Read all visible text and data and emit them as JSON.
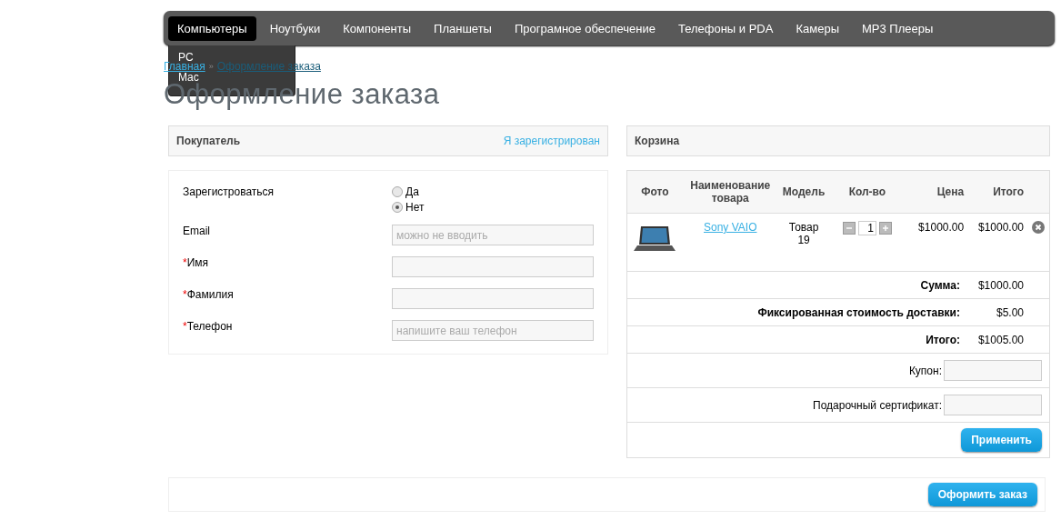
{
  "nav": {
    "items": [
      {
        "label": "Компьютеры",
        "selected": true
      },
      {
        "label": "Ноутбуки",
        "selected": false
      },
      {
        "label": "Компоненты",
        "selected": false
      },
      {
        "label": "Планшеты",
        "selected": false
      },
      {
        "label": "Програмное обеспечение",
        "selected": false
      },
      {
        "label": "Телефоны и PDA",
        "selected": false
      },
      {
        "label": "Камеры",
        "selected": false
      },
      {
        "label": "MP3 Плееры",
        "selected": false
      }
    ],
    "dropdown": [
      "PC",
      "Mac"
    ]
  },
  "breadcrumb": {
    "items": [
      "Главная",
      "Оформление заказа"
    ],
    "separator": "»"
  },
  "page_title": "Оформление заказа",
  "customer": {
    "title": "Покупатель",
    "login_link": "Я зарегистрирован",
    "required_mark": "*",
    "fields": [
      {
        "kind": "radio",
        "label": "Зарегистроваться",
        "options": [
          {
            "label": "Да",
            "selected": false
          },
          {
            "label": "Нет",
            "selected": true
          }
        ]
      },
      {
        "kind": "text",
        "label": "Email",
        "required": false,
        "placeholder": "можно не вводить"
      },
      {
        "kind": "text",
        "label": "Имя",
        "required": true
      },
      {
        "kind": "text",
        "label": "Фамилия",
        "required": true
      },
      {
        "kind": "text",
        "label": "Телефон",
        "required": true,
        "placeholder": "напишите ваш телефон"
      }
    ]
  },
  "cart": {
    "title": "Корзина",
    "columns": [
      "Фото",
      "Наименование товара",
      "Модель",
      "Кол-во",
      "Цена",
      "Итого"
    ],
    "items": [
      {
        "name": "Sony VAIO",
        "model": "Товар 19",
        "quantity": "1",
        "price": "$1000.00",
        "total": "$1000.00"
      }
    ],
    "totals": [
      {
        "label": "Сумма:",
        "value": "$1000.00"
      },
      {
        "label": "Фиксированная стоимость доставки:",
        "value": "$5.00"
      },
      {
        "label": "Итого:",
        "value": "$1005.00"
      }
    ],
    "codes": [
      "Купон:",
      "Подарочный сертификат:"
    ],
    "apply_button": "Применить"
  },
  "checkout_button": "Оформить заказ"
}
